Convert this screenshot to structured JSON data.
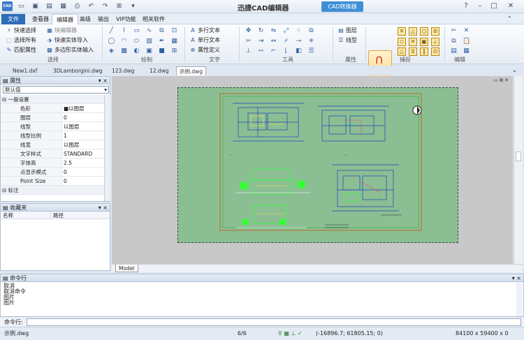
{
  "app": {
    "title": "迅捷CAD编辑器",
    "logo": "CAD",
    "convert_button": "CAD转换器"
  },
  "menu": [
    "文件",
    "查看器",
    "编辑器",
    "高级",
    "输出",
    "VIP功能",
    "相关软件"
  ],
  "ribbon": {
    "select": {
      "label": "选择",
      "items": [
        "快速选择",
        "选择所有",
        "匹配属性",
        "块编辑器",
        "快速实体导入",
        "多边形实体输入"
      ]
    },
    "draw": {
      "label": "绘制"
    },
    "text": {
      "label": "文字",
      "items": [
        "多行文本",
        "单行文本",
        "属性定义"
      ]
    },
    "tools": {
      "label": "工具"
    },
    "props": {
      "label": "属性",
      "items": [
        "图层",
        "线型"
      ]
    },
    "snap": {
      "label": "捕捉",
      "button": "捕捉"
    },
    "edit": {
      "label": "编辑"
    }
  },
  "doc_tabs": [
    "New1.dxf",
    "3DLamborgini.dwg",
    "123.dwg",
    "12.dwg",
    "示例.dwg"
  ],
  "props_panel": {
    "title": "属性",
    "layer_select": "默认值",
    "section_general": "一般设置",
    "rows": [
      {
        "k": "色彩",
        "v": "以图层"
      },
      {
        "k": "图层",
        "v": "0"
      },
      {
        "k": "线型",
        "v": "以图层"
      },
      {
        "k": "线型比例",
        "v": "1"
      },
      {
        "k": "线宽",
        "v": "以图层"
      },
      {
        "k": "文字样式",
        "v": "STANDARD"
      },
      {
        "k": "字体高",
        "v": "2.5"
      },
      {
        "k": "点显示模式",
        "v": "0"
      },
      {
        "k": "Point Size",
        "v": "0"
      }
    ],
    "section_label": "标注"
  },
  "fav_panel": {
    "title": "收藏夹",
    "col_name": "名称",
    "col_path": "路径"
  },
  "canvas": {
    "model_tab": "Model",
    "bg": "#8bbf93"
  },
  "cmd": {
    "title": "命令行",
    "lines": [
      "取消",
      "取消命令",
      "图片",
      "图片"
    ],
    "input_label": "命令行:"
  },
  "status": {
    "file": "示例.dwg",
    "pages": "6/6",
    "coords": "(-16896.7; 61805.15; 0)",
    "size": "84100 x 59400 x 0"
  }
}
